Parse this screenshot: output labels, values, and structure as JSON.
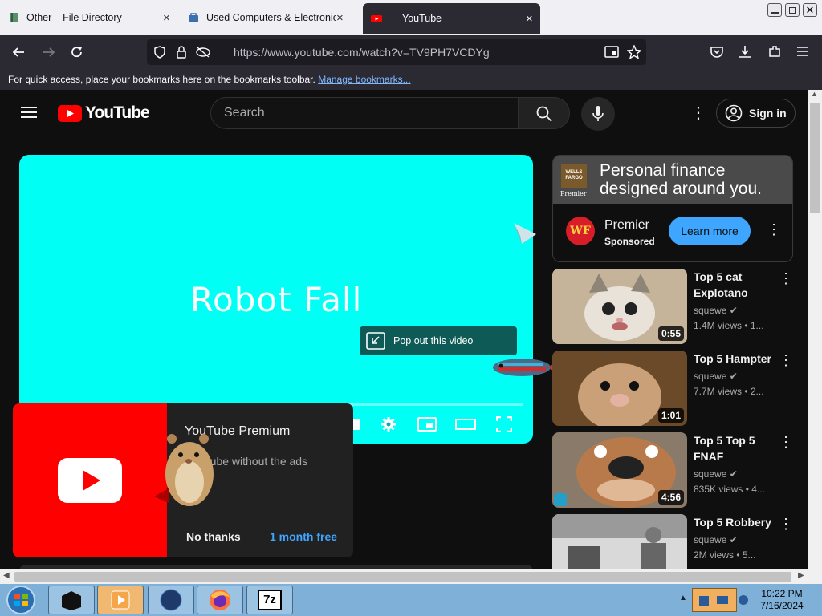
{
  "browser": {
    "tabs": [
      {
        "title": "Other – File Directory",
        "close": "×"
      },
      {
        "title": "Used Computers & Electronics",
        "close": "×"
      },
      {
        "title": "YouTube",
        "close": "×"
      }
    ],
    "url": "https://www.youtube.com/watch?v=TV9PH7VCDYg",
    "bookmarks_text": "For quick access, place your bookmarks here on the bookmarks toolbar.",
    "bookmarks_link": "Manage bookmarks..."
  },
  "youtube": {
    "logo_text": "YouTube",
    "search_placeholder": "Search",
    "sign_in": "Sign in",
    "video_title_overlay": "Robot Fall",
    "progress_played_fraction": 0.09,
    "pop_out_label": "Pop out this video",
    "premium": {
      "title": "YouTube Premium",
      "subtitle": "YouTube without the ads",
      "decline": "No thanks",
      "accept": "1 month free"
    },
    "ad": {
      "brand_lines": [
        "WELLS",
        "FARGO"
      ],
      "brand_caption": "Premier",
      "headline": "Personal finance designed around you.",
      "logo_text": "WF",
      "name": "Premier",
      "sponsored": "Sponsored",
      "cta": "Learn more"
    },
    "recommendations": [
      {
        "title": "Top 5 cat Explotano",
        "channel": "squewe",
        "meta": "1.4M views • 1...",
        "duration": "0:55"
      },
      {
        "title": "Top 5 Hampter",
        "channel": "squewe",
        "meta": "7.7M views • 2...",
        "duration": "1:01"
      },
      {
        "title": "Top 5 Top 5 FNAF",
        "channel": "squewe",
        "meta": "835K views • 4...",
        "duration": "4:56"
      },
      {
        "title": "Top 5 Robbery",
        "channel": "squewe",
        "meta": "2M views • 5...",
        "duration": ""
      }
    ]
  },
  "taskbar": {
    "time": "10:22 PM",
    "date": "7/16/2024",
    "apps": [
      "terminal",
      "media-player",
      "globe",
      "firefox",
      "7-zip"
    ],
    "seven_zip_label": "7z"
  },
  "colors": {
    "accent_red": "#ff0000",
    "link_blue": "#3ea6ff",
    "video_bg": "#00fff5"
  }
}
